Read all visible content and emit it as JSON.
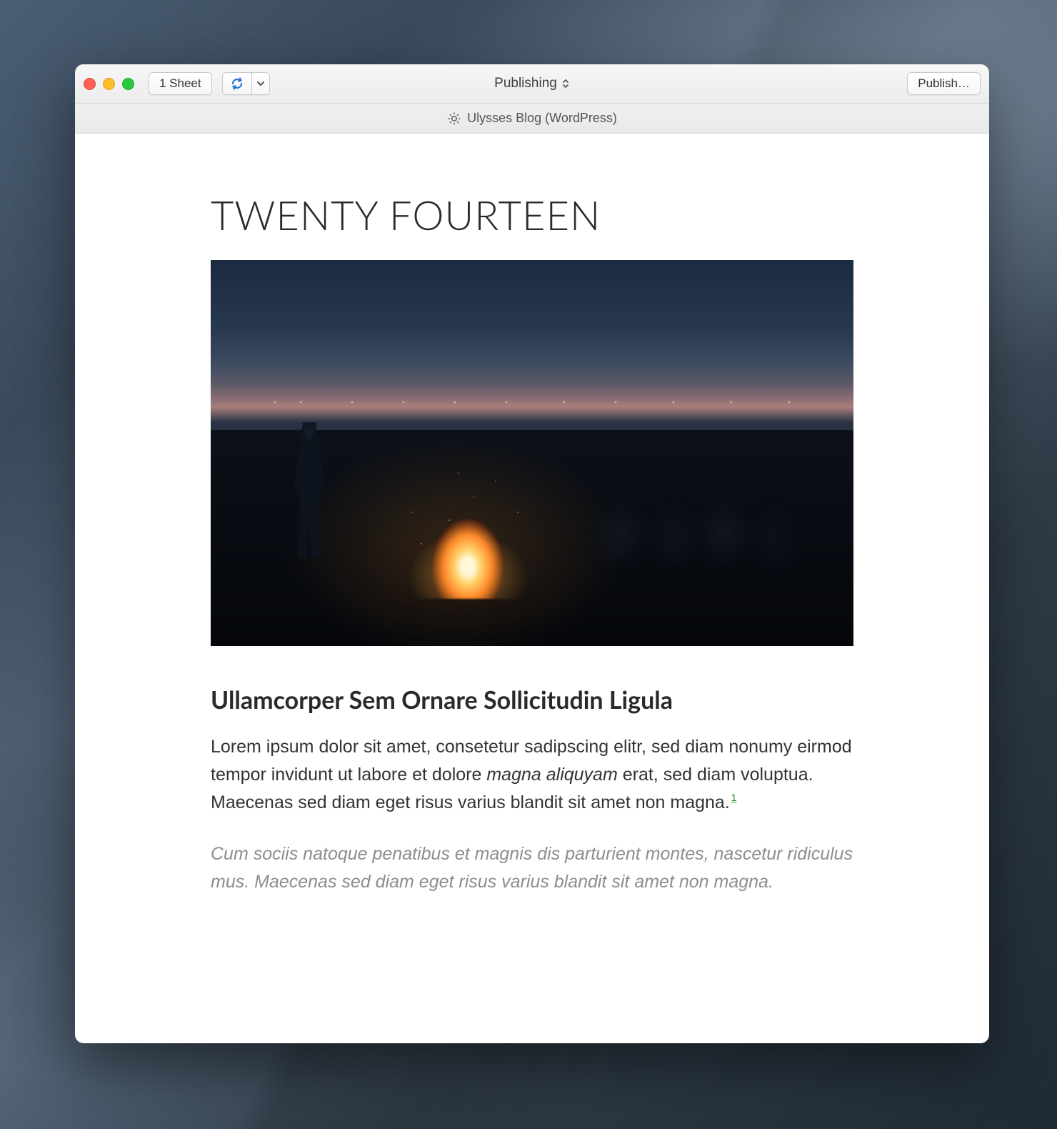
{
  "toolbar": {
    "sheet_button_label": "1 Sheet",
    "title": "Publishing",
    "publish_button_label": "Publish…"
  },
  "subheader": {
    "account_label": "Ulysses Blog (WordPress)"
  },
  "post": {
    "site_title": "TWENTY FOURTEEN",
    "heading": "Ullamcorper Sem Ornare Sollicitudin Ligula",
    "paragraph_pre": "Lorem ipsum dolor sit amet, consetetur sadipscing elitr, sed diam nonumy eirmod tempor invidunt ut labore et dolore ",
    "paragraph_em": "magna aliquyam",
    "paragraph_post": " erat, sed diam voluptua. Maecenas sed diam eget risus varius blandit sit amet non magna.",
    "footnote_ref": "1",
    "blockquote": "Cum sociis natoque penatibus et magnis dis parturient montes, nascetur ridiculus mus. Maecenas sed diam eget risus varius blandit sit amet non magna."
  },
  "icons": {
    "refresh": "refresh-icon",
    "dropdown": "chevron-down-icon",
    "updown": "sort-icon",
    "gear": "gear-icon"
  }
}
